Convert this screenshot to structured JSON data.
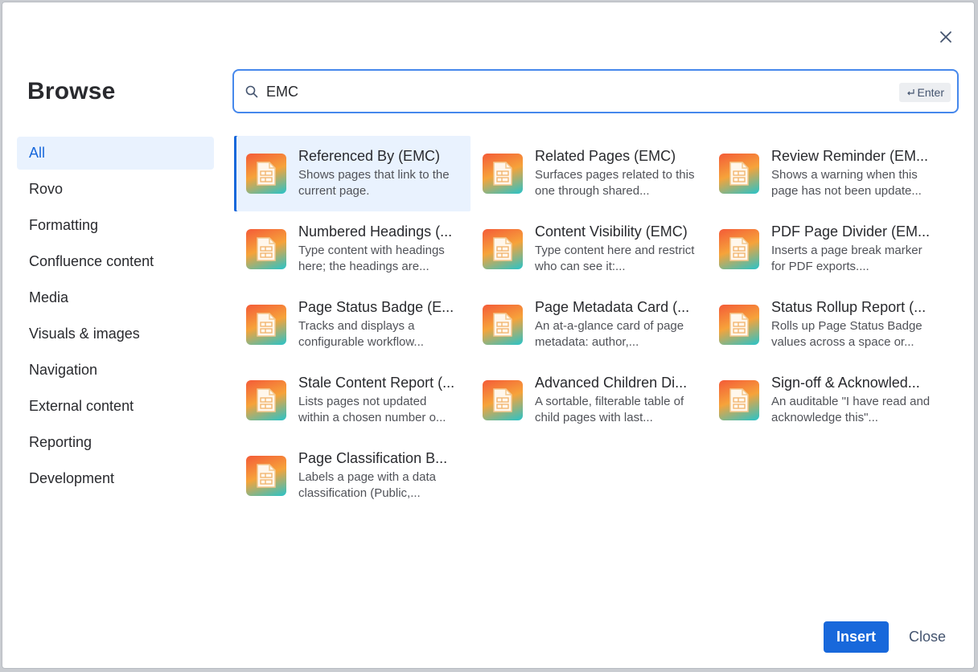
{
  "dialog": {
    "title": "Browse",
    "close_icon": "close-icon"
  },
  "search": {
    "value": "EMC",
    "placeholder": "",
    "enter_hint": "Enter",
    "icon": "search-icon"
  },
  "sidebar": {
    "active_index": 0,
    "items": [
      {
        "label": "All"
      },
      {
        "label": "Rovo"
      },
      {
        "label": "Formatting"
      },
      {
        "label": "Confluence content"
      },
      {
        "label": "Media"
      },
      {
        "label": "Visuals & images"
      },
      {
        "label": "Navigation"
      },
      {
        "label": "External content"
      },
      {
        "label": "Reporting"
      },
      {
        "label": "Development"
      }
    ]
  },
  "results": [
    {
      "title": "Referenced By (EMC)",
      "desc": "Shows pages that link to the current page.",
      "selected": true
    },
    {
      "title": "Related Pages (EMC)",
      "desc": "Surfaces pages related to this one through shared..."
    },
    {
      "title": "Review Reminder (EM...",
      "desc": "Shows a warning when this page has not been update..."
    },
    {
      "title": "Numbered Headings (...",
      "desc": "Type content with headings here; the headings are..."
    },
    {
      "title": "Content Visibility (EMC)",
      "desc": "Type content here and restrict who can see it:..."
    },
    {
      "title": "PDF Page Divider (EM...",
      "desc": "Inserts a page break marker for PDF exports...."
    },
    {
      "title": "Page Status Badge (E...",
      "desc": "Tracks and displays a configurable workflow..."
    },
    {
      "title": "Page Metadata Card (...",
      "desc": "An at-a-glance card of page metadata: author,..."
    },
    {
      "title": "Status Rollup Report (...",
      "desc": "Rolls up Page Status Badge values across a space or..."
    },
    {
      "title": "Stale Content Report (...",
      "desc": "Lists pages not updated within a chosen number o..."
    },
    {
      "title": "Advanced Children Di...",
      "desc": "A sortable, filterable table of child pages with last..."
    },
    {
      "title": "Sign-off & Acknowled...",
      "desc": "An auditable \"I have read and acknowledge this\"..."
    },
    {
      "title": "Page Classification B...",
      "desc": "Labels a page with a data classification (Public,..."
    }
  ],
  "result_icon": "macro-document-icon",
  "footer": {
    "insert_label": "Insert",
    "close_label": "Close"
  },
  "colors": {
    "accent": "#1868db",
    "selected_bg": "#e9f2fe",
    "search_border": "#4688ec"
  }
}
